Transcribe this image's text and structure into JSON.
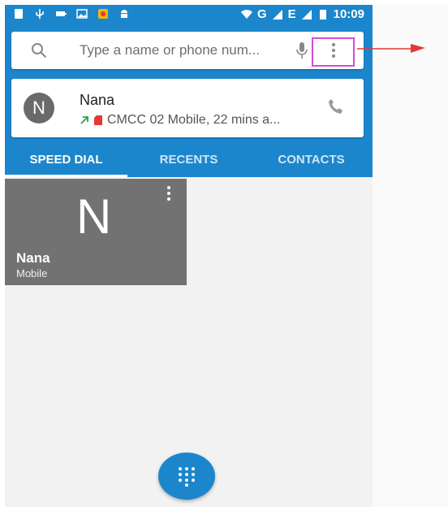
{
  "statusbar": {
    "network": "G",
    "network2": "E",
    "time": "10:09"
  },
  "search": {
    "placeholder": "Type a name or phone num..."
  },
  "recent_contact": {
    "initial": "N",
    "name": "Nana",
    "detail": "CMCC 02 Mobile, 22 mins a..."
  },
  "tabs": [
    {
      "label": "SPEED DIAL",
      "active": true
    },
    {
      "label": "RECENTS",
      "active": false
    },
    {
      "label": "CONTACTS",
      "active": false
    }
  ],
  "speed_dial": {
    "initial": "N",
    "name": "Nana",
    "type": "Mobile"
  },
  "colors": {
    "accent": "#1b86cc",
    "highlight": "#d64ad6",
    "arrow": "#e53935"
  },
  "icons": [
    "sim-icon",
    "usb-icon",
    "battery-small-icon",
    "image-icon",
    "app-icon",
    "android-icon",
    "wifi-icon",
    "signal-icon",
    "battery-icon",
    "search-icon",
    "mic-icon",
    "more-vert-icon",
    "call-icon",
    "dialpad-icon"
  ]
}
